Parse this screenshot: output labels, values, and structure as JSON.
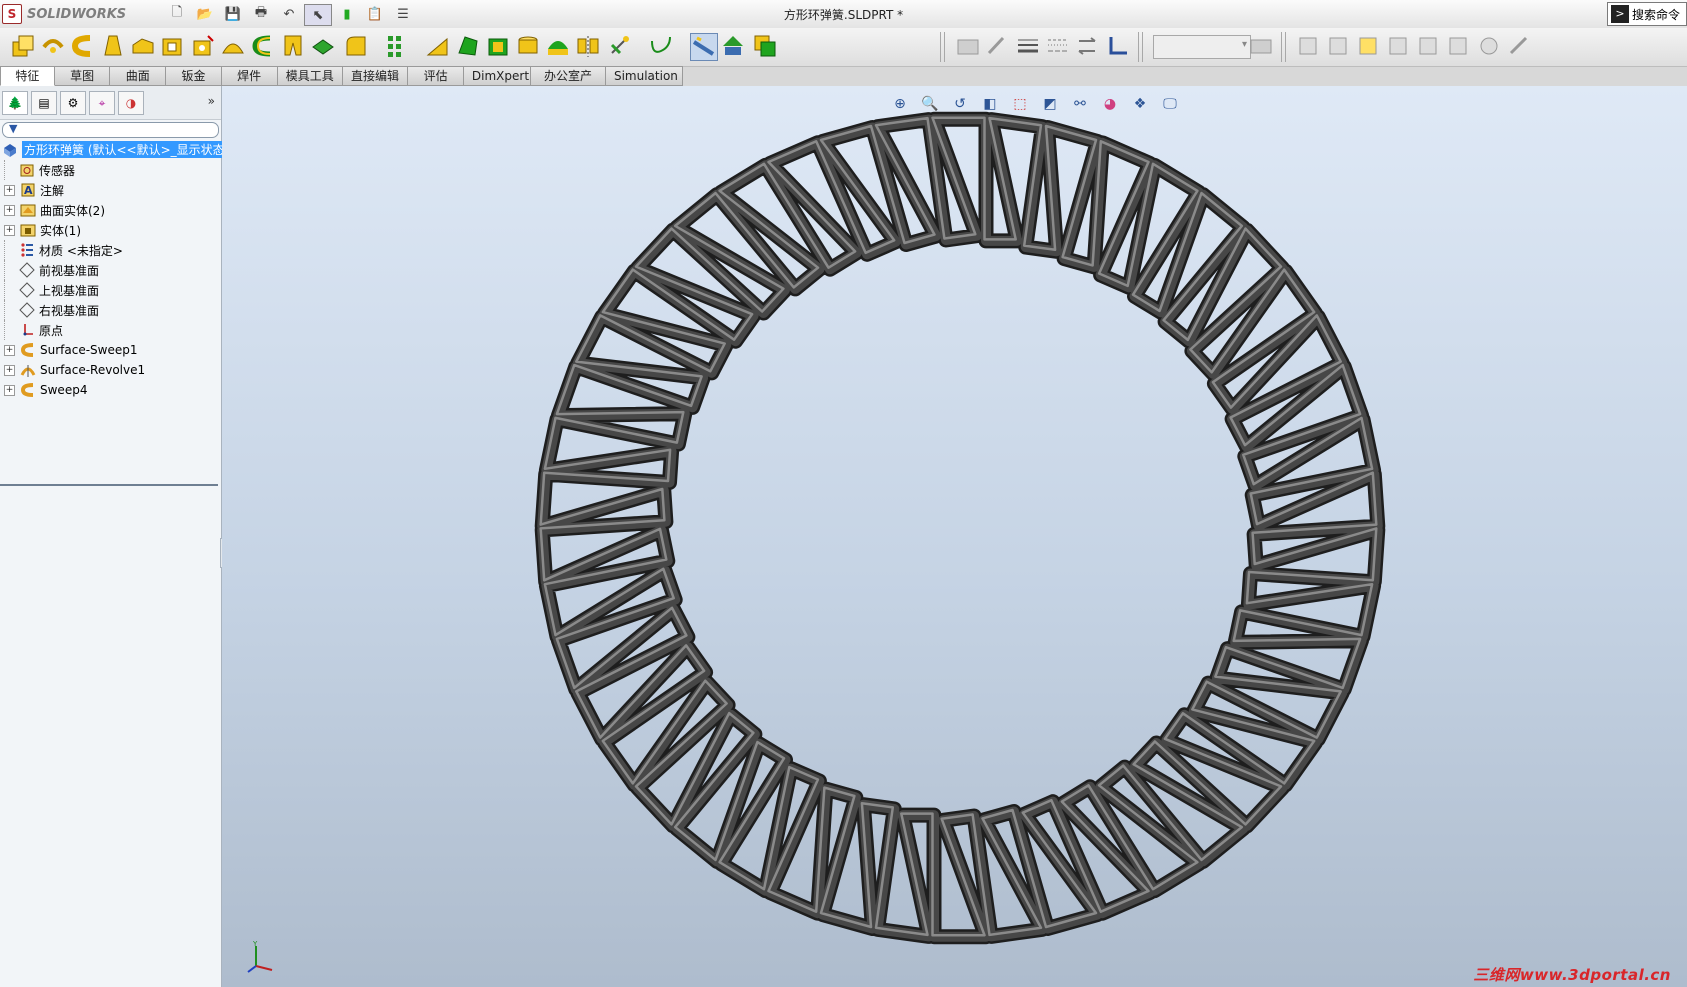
{
  "app": {
    "name": "SOLIDWORKS"
  },
  "window": {
    "document_title": "方形环弹簧.SLDPRT *",
    "search_label": "搜索命令"
  },
  "tabs": [
    {
      "label": "特征",
      "active": true
    },
    {
      "label": "草图"
    },
    {
      "label": "曲面"
    },
    {
      "label": "钣金"
    },
    {
      "label": "焊件"
    },
    {
      "label": "模具工具"
    },
    {
      "label": "直接编辑"
    },
    {
      "label": "评估"
    },
    {
      "label": "DimXpert"
    },
    {
      "label": "办公室产品"
    },
    {
      "label": "Simulation"
    }
  ],
  "tree": {
    "root": "方形环弹簧  (默认<<默认>_显示状态",
    "items": [
      {
        "label": "传感器",
        "icon": "sensor-icon",
        "expandable": false
      },
      {
        "label": "注解",
        "icon": "annotation-icon",
        "expandable": true
      },
      {
        "label": "曲面实体(2)",
        "icon": "surface-bodies-icon",
        "expandable": true
      },
      {
        "label": "实体(1)",
        "icon": "solid-bodies-icon",
        "expandable": true
      },
      {
        "label": "材质 <未指定>",
        "icon": "material-icon",
        "expandable": false
      },
      {
        "label": "前视基准面",
        "icon": "plane-icon",
        "expandable": false
      },
      {
        "label": "上视基准面",
        "icon": "plane-icon",
        "expandable": false
      },
      {
        "label": "右视基准面",
        "icon": "plane-icon",
        "expandable": false
      },
      {
        "label": "原点",
        "icon": "origin-icon",
        "expandable": false
      },
      {
        "label": "Surface-Sweep1",
        "icon": "sweep-icon",
        "expandable": true
      },
      {
        "label": "Surface-Revolve1",
        "icon": "revolve-icon",
        "expandable": true
      },
      {
        "label": "Sweep4",
        "icon": "sweep-icon",
        "expandable": true
      }
    ]
  },
  "graphics": {
    "watermark": "三维网www.3dportal.cn",
    "coils": 46
  },
  "colors": {
    "accent": "#3399ff",
    "spring": "#474747",
    "watermark": "#d9262a"
  }
}
